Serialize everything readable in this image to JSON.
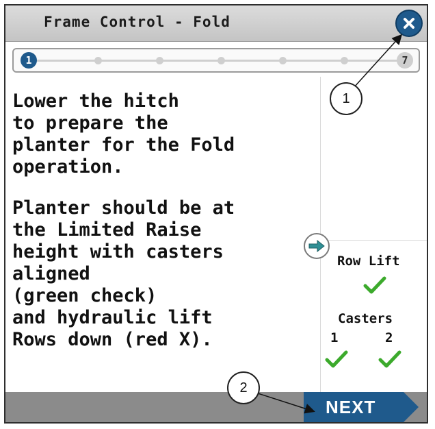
{
  "dialog": {
    "title": "Frame Control - Fold"
  },
  "progress": {
    "current_step": "1",
    "last_step": "7"
  },
  "instructions": {
    "paragraph1": "Lower the hitch\nto prepare the\nplanter for the Fold\noperation.",
    "paragraph2": "Planter should be at\nthe Limited Raise\nheight with casters\naligned\n(green check)\nand hydraulic lift\nRows down (red X)."
  },
  "status": {
    "row_lift_label": "Row Lift",
    "casters_label": "Casters",
    "caster1_label": "1",
    "caster2_label": "2",
    "check_color": "#3caa2c"
  },
  "footer": {
    "next_label": "NEXT"
  },
  "callouts": {
    "one": "1",
    "two": "2"
  },
  "colors": {
    "accent": "#1f5a8c",
    "footer": "#8b8b8b"
  },
  "icons": [
    "close-icon",
    "arrow-right-icon",
    "check-icon"
  ]
}
